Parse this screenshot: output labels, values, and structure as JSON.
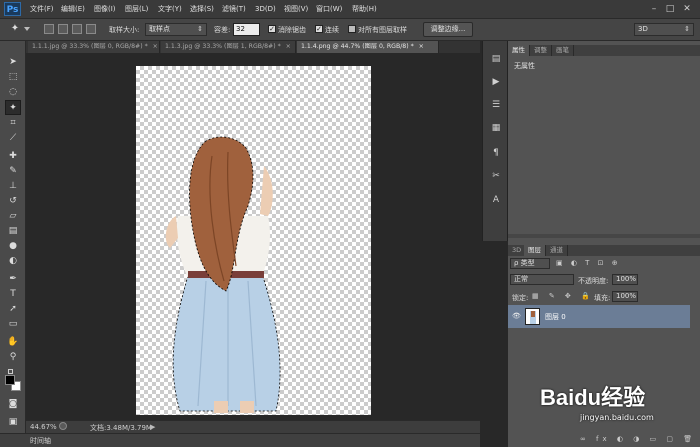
{
  "app": {
    "logo": "Ps"
  },
  "menu": [
    "文件(F)",
    "编辑(E)",
    "图像(I)",
    "图层(L)",
    "文字(Y)",
    "选择(S)",
    "滤镜(T)",
    "3D(D)",
    "视图(V)",
    "窗口(W)",
    "帮助(H)"
  ],
  "window_controls": {
    "minimize": "–",
    "maximize": "□",
    "close": "✕"
  },
  "options": {
    "sample_size_label": "取样大小:",
    "sample_size_value": "取样点",
    "tolerance_label": "容差:",
    "tolerance_value": "32",
    "antialias_label": "消除锯齿",
    "contiguous_label": "连续",
    "all_layers_label": "对所有图层取样",
    "refine_edge_button": "调整边缘...",
    "workspace_value": "3D"
  },
  "tabs": [
    {
      "label": "1.1.1.jpg @ 33.3% (图层 0, RGB/8#) *",
      "close": "×",
      "active": false
    },
    {
      "label": "1.1.3.jpg @ 33.3% (图层 1, RGB/8#) *",
      "close": "×",
      "active": false
    },
    {
      "label": "1.1.4.png @ 44.7% (图层 0, RGB/8) *",
      "close": "×",
      "active": true
    }
  ],
  "status": {
    "zoom": "44.67%",
    "doc_info": "文档:3.48M/3.79M",
    "arrow": "▶"
  },
  "timeline_tab": "时间轴",
  "properties_panel": {
    "tabs": [
      "属性",
      "调整",
      "画笔"
    ],
    "content": "无属性"
  },
  "layers_panel": {
    "tabs": [
      "3D",
      "图层",
      "通道"
    ],
    "filter_value": "ρ 类型",
    "blend_mode": "正常",
    "opacity_label": "不透明度:",
    "opacity_value": "100%",
    "lock_label": "锁定:",
    "fill_label": "填充:",
    "fill_value": "100%",
    "layers": [
      {
        "name": "图层 0",
        "visible": true,
        "selected": true
      }
    ]
  },
  "watermark": {
    "text": "Baidu经验",
    "url": "jingyan.baidu.com"
  },
  "colors": {
    "accent": "#4aa3ff",
    "layer_selected": "#6b7d96",
    "panel_bg": "#535353"
  }
}
